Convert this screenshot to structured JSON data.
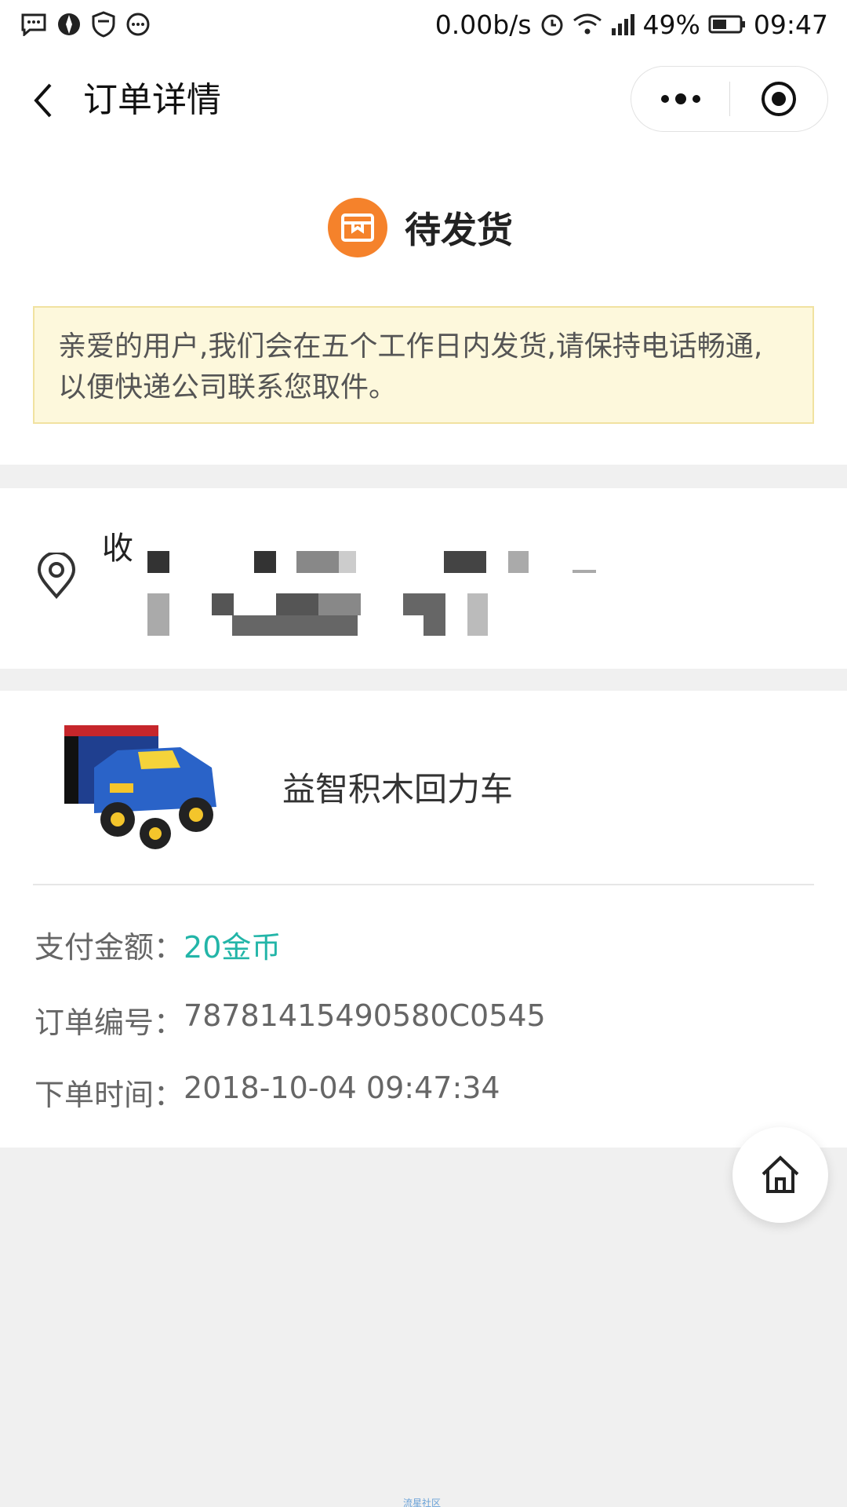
{
  "statusbar": {
    "net_speed": "0.00b/s",
    "battery": "49%",
    "time": "09:47"
  },
  "nav": {
    "title": "订单详情"
  },
  "order_status": {
    "label": "待发货",
    "notice": "亲爱的用户,我们会在五个工作日内发货,请保持电话畅通,以便快递公司联系您取件。"
  },
  "address": {
    "label_prefix": "收"
  },
  "product": {
    "name": "益智积木回力车"
  },
  "info": {
    "amount_label": "支付金额：",
    "amount_value": "20金币",
    "order_no_label": "订单编号：",
    "order_no_value": "78781415490580C0545",
    "time_label": "下单时间：",
    "time_value": "2018-10-04 09:47:34"
  },
  "colors": {
    "status_icon": "#f5822b",
    "money": "#23b5a8",
    "notice_bg": "#fdf8dc"
  },
  "watermark": "流星社区"
}
